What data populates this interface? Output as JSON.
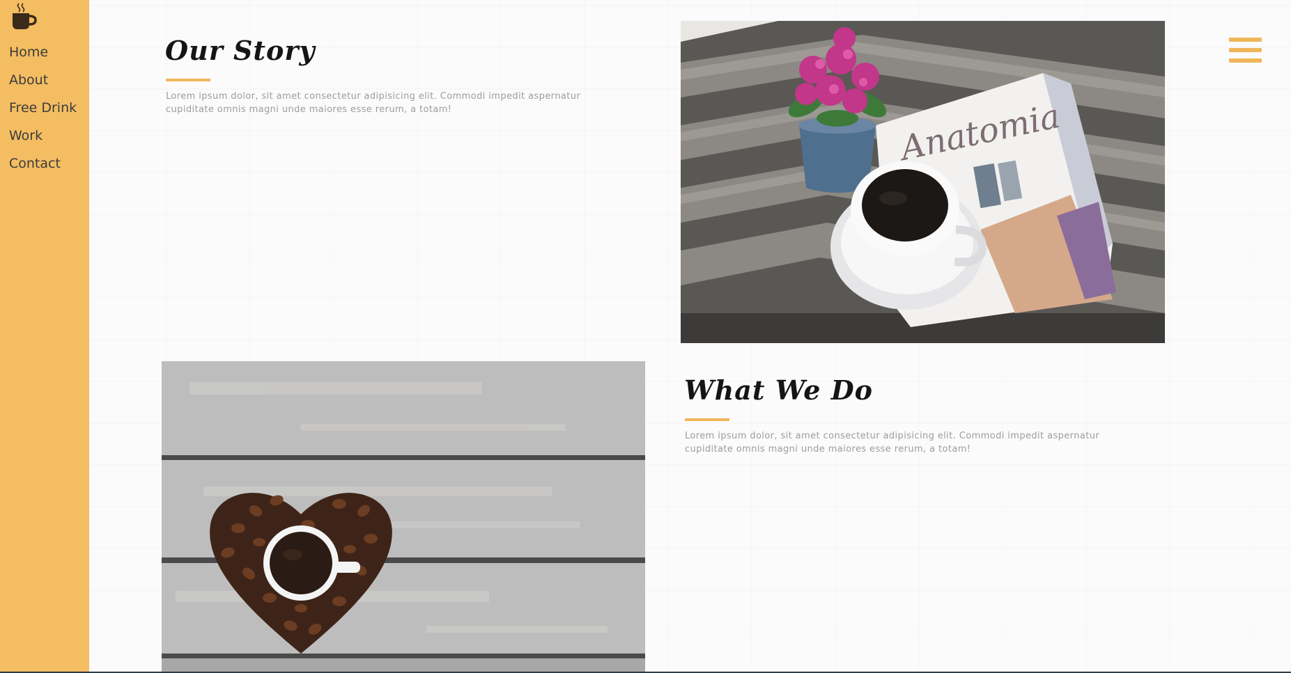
{
  "sidebar": {
    "logo_icon": "coffee-mug-icon",
    "nav_items": [
      "Home",
      "About",
      "Free Drink",
      "Work",
      "Contact"
    ]
  },
  "header": {
    "menu_icon": "hamburger-menu-icon"
  },
  "sections": {
    "our_story": {
      "title": "Our Story",
      "text": "Lorem ipsum dolor, sit amet consectetur adipisicing elit. Commodi impedit aspernatur cupiditate omnis magni unde maiores esse rerum, a totam!",
      "image": "coffee-cup-magazine-flowers-photo"
    },
    "what_we_do": {
      "title": "What We Do",
      "text": "Lorem ipsum dolor, sit amet consectetur adipisicing elit. Commodi impedit aspernatur cupiditate omnis magni unde maiores esse rerum, a totam!",
      "image": "coffee-beans-heart-photo"
    }
  },
  "colors": {
    "accent": "#f4bd62",
    "text_dark": "#151515",
    "text_muted": "#9c9c9c"
  }
}
